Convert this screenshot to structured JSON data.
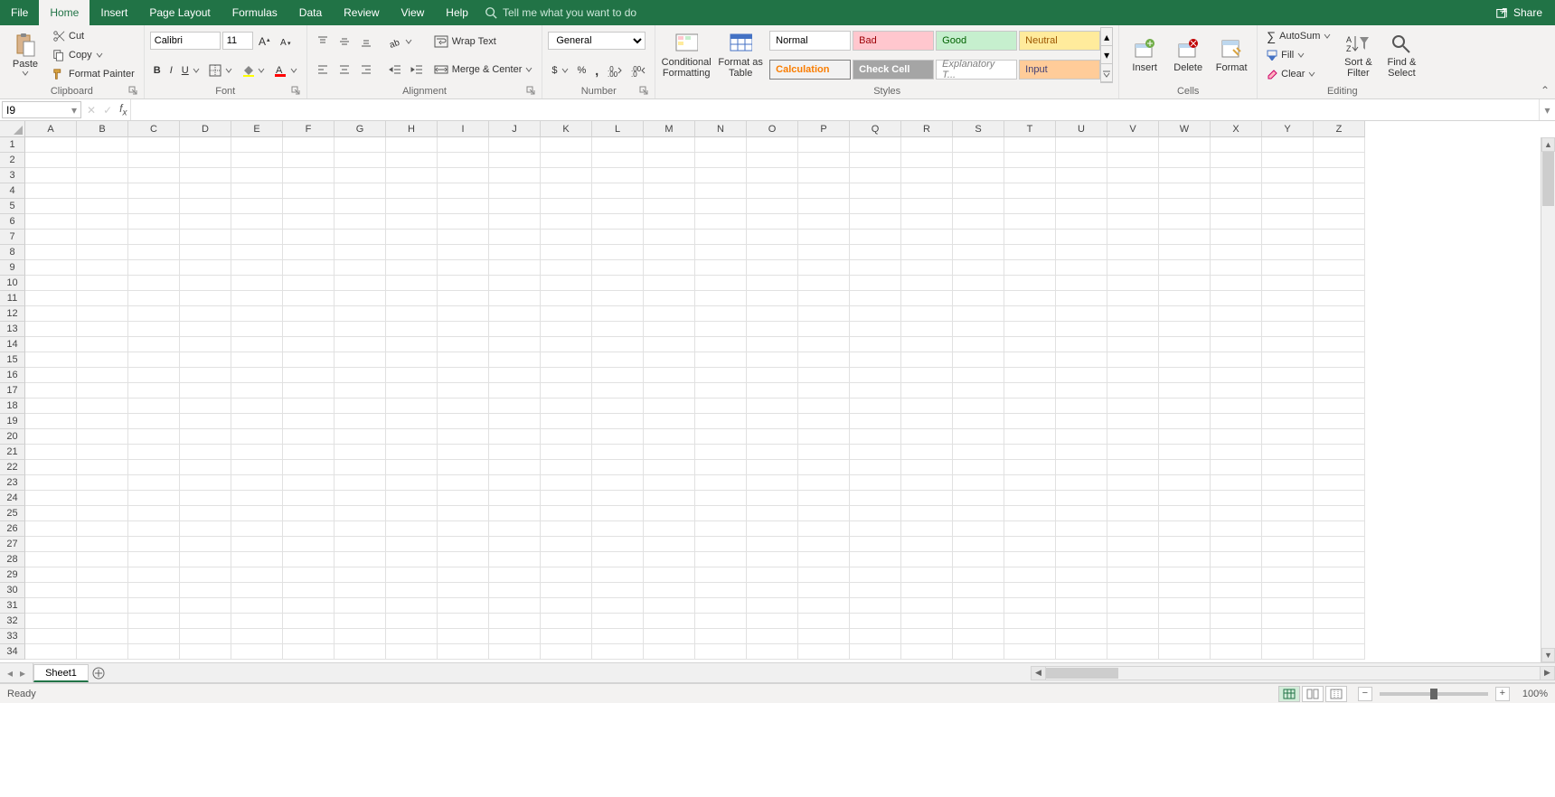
{
  "tabs": [
    "File",
    "Home",
    "Insert",
    "Page Layout",
    "Formulas",
    "Data",
    "Review",
    "View",
    "Help"
  ],
  "active_tab": "Home",
  "tellme_placeholder": "Tell me what you want to do",
  "share_label": "Share",
  "clipboard": {
    "paste": "Paste",
    "cut": "Cut",
    "copy": "Copy",
    "format_painter": "Format Painter",
    "label": "Clipboard"
  },
  "font": {
    "name": "Calibri",
    "size": "11",
    "label": "Font"
  },
  "alignment": {
    "wrap": "Wrap Text",
    "merge": "Merge & Center",
    "label": "Alignment"
  },
  "number": {
    "format": "General",
    "label": "Number"
  },
  "stylesg": {
    "cond": "Conditional Formatting",
    "table": "Format as Table",
    "label": "Styles",
    "normal": "Normal",
    "bad": "Bad",
    "good": "Good",
    "neutral": "Neutral",
    "calc": "Calculation",
    "check": "Check Cell",
    "exp": "Explanatory T...",
    "input": "Input"
  },
  "cells": {
    "insert": "Insert",
    "delete": "Delete",
    "format": "Format",
    "label": "Cells"
  },
  "editing": {
    "autosum": "AutoSum",
    "fill": "Fill",
    "clear": "Clear",
    "sort": "Sort & Filter",
    "find": "Find & Select",
    "label": "Editing"
  },
  "namebox": "I9",
  "columns": [
    "A",
    "B",
    "C",
    "D",
    "E",
    "F",
    "G",
    "H",
    "I",
    "J",
    "K",
    "L",
    "M",
    "N",
    "O",
    "P",
    "Q",
    "R",
    "S",
    "T",
    "U",
    "V",
    "W",
    "X",
    "Y",
    "Z"
  ],
  "row_count": 34,
  "sheet": "Sheet1",
  "status": "Ready",
  "zoom": "100%"
}
